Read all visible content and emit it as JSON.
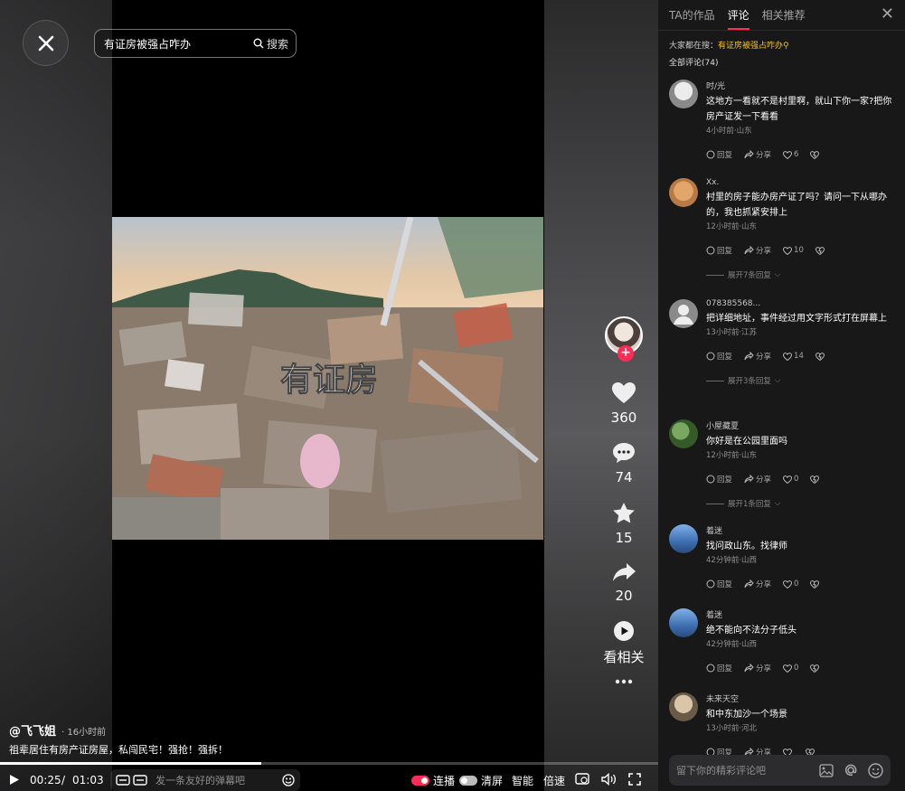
{
  "search": {
    "query": "有证房被强占咋办",
    "button_label": "搜索"
  },
  "video": {
    "overlay_text": "有证房"
  },
  "author": {
    "name": "@飞飞姐",
    "time": "· 16小时前",
    "description": "祖辈居住有房产证房屋，私闯民宅！强抢！强拆！"
  },
  "actions": {
    "likes": "360",
    "comments": "74",
    "favorites": "15",
    "shares": "20",
    "related_label": "看相关"
  },
  "player": {
    "current_time": "00:25",
    "separator": "/",
    "duration": "01:03",
    "progress": 0.397,
    "danmaku_placeholder": "发一条友好的弹幕吧",
    "autoplay_label": "连播",
    "clear_label": "清屏",
    "quality_label": "智能",
    "speed_label": "倍速"
  },
  "panel": {
    "tabs": [
      "TA的作品",
      "评论",
      "相关推荐"
    ],
    "active_tab": 1,
    "hot_prefix": "大家都在搜：",
    "hot_query": "有证房被强占咋办",
    "total_label": "全部评论(74)",
    "reply_label": "回复",
    "share_label": "分享",
    "comment_placeholder": "留下你的精彩评论吧"
  },
  "comments": [
    {
      "user": "时/光",
      "text": "这地方一看就不是村里啊，就山下你一家?把你房产证发一下看看",
      "meta": "4小时前·山东",
      "likes": "6",
      "expand": ""
    },
    {
      "user": "Xx.",
      "text": "村里的房子能办房产证了吗？请问一下从哪办的，我也抓紧安排上",
      "meta": "12小时前·山东",
      "likes": "10",
      "expand": "展开7条回复"
    },
    {
      "user": "078385568...",
      "text": "把详细地址，事件经过用文字形式打在屏幕上",
      "meta": "13小时前·江苏",
      "likes": "14",
      "expand": "展开3条回复"
    },
    {
      "user": "小屋藏夏",
      "text": "你好是在公园里面吗",
      "meta": "12小时前·山东",
      "likes": "0",
      "expand": "展开1条回复"
    },
    {
      "user": "着迷",
      "text": "找问政山东。找律师",
      "meta": "42分钟前·山西",
      "likes": "0",
      "expand": ""
    },
    {
      "user": "着迷",
      "text": "绝不能向不法分子低头",
      "meta": "42分钟前·山西",
      "likes": "0",
      "expand": ""
    },
    {
      "user": "未来天空",
      "text": "和中东加沙一个场景",
      "meta": "13小时前·河北",
      "likes": "",
      "expand": ""
    }
  ],
  "colors": {
    "accent": "#fe2c55",
    "hot": "#f5c518",
    "panel_bg": "#181818"
  }
}
